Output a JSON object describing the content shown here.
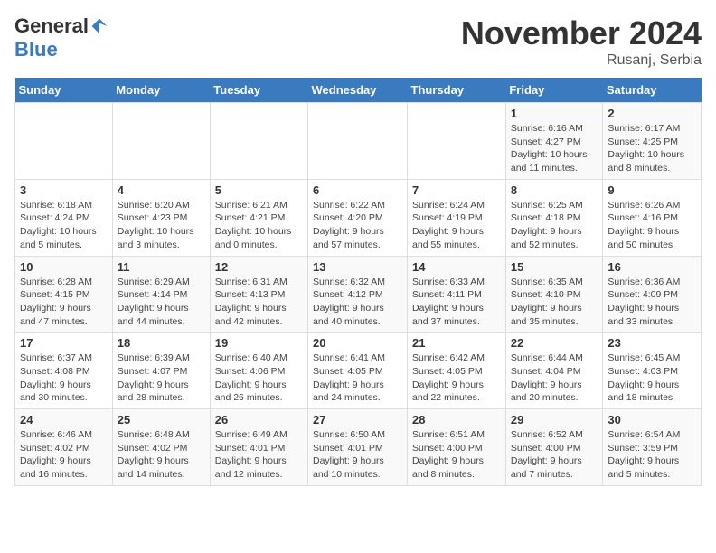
{
  "logo": {
    "general": "General",
    "blue": "Blue"
  },
  "header": {
    "month": "November 2024",
    "location": "Rusanj, Serbia"
  },
  "weekdays": [
    "Sunday",
    "Monday",
    "Tuesday",
    "Wednesday",
    "Thursday",
    "Friday",
    "Saturday"
  ],
  "weeks": [
    [
      {
        "day": "",
        "info": ""
      },
      {
        "day": "",
        "info": ""
      },
      {
        "day": "",
        "info": ""
      },
      {
        "day": "",
        "info": ""
      },
      {
        "day": "",
        "info": ""
      },
      {
        "day": "1",
        "info": "Sunrise: 6:16 AM\nSunset: 4:27 PM\nDaylight: 10 hours and 11 minutes."
      },
      {
        "day": "2",
        "info": "Sunrise: 6:17 AM\nSunset: 4:25 PM\nDaylight: 10 hours and 8 minutes."
      }
    ],
    [
      {
        "day": "3",
        "info": "Sunrise: 6:18 AM\nSunset: 4:24 PM\nDaylight: 10 hours and 5 minutes."
      },
      {
        "day": "4",
        "info": "Sunrise: 6:20 AM\nSunset: 4:23 PM\nDaylight: 10 hours and 3 minutes."
      },
      {
        "day": "5",
        "info": "Sunrise: 6:21 AM\nSunset: 4:21 PM\nDaylight: 10 hours and 0 minutes."
      },
      {
        "day": "6",
        "info": "Sunrise: 6:22 AM\nSunset: 4:20 PM\nDaylight: 9 hours and 57 minutes."
      },
      {
        "day": "7",
        "info": "Sunrise: 6:24 AM\nSunset: 4:19 PM\nDaylight: 9 hours and 55 minutes."
      },
      {
        "day": "8",
        "info": "Sunrise: 6:25 AM\nSunset: 4:18 PM\nDaylight: 9 hours and 52 minutes."
      },
      {
        "day": "9",
        "info": "Sunrise: 6:26 AM\nSunset: 4:16 PM\nDaylight: 9 hours and 50 minutes."
      }
    ],
    [
      {
        "day": "10",
        "info": "Sunrise: 6:28 AM\nSunset: 4:15 PM\nDaylight: 9 hours and 47 minutes."
      },
      {
        "day": "11",
        "info": "Sunrise: 6:29 AM\nSunset: 4:14 PM\nDaylight: 9 hours and 44 minutes."
      },
      {
        "day": "12",
        "info": "Sunrise: 6:31 AM\nSunset: 4:13 PM\nDaylight: 9 hours and 42 minutes."
      },
      {
        "day": "13",
        "info": "Sunrise: 6:32 AM\nSunset: 4:12 PM\nDaylight: 9 hours and 40 minutes."
      },
      {
        "day": "14",
        "info": "Sunrise: 6:33 AM\nSunset: 4:11 PM\nDaylight: 9 hours and 37 minutes."
      },
      {
        "day": "15",
        "info": "Sunrise: 6:35 AM\nSunset: 4:10 PM\nDaylight: 9 hours and 35 minutes."
      },
      {
        "day": "16",
        "info": "Sunrise: 6:36 AM\nSunset: 4:09 PM\nDaylight: 9 hours and 33 minutes."
      }
    ],
    [
      {
        "day": "17",
        "info": "Sunrise: 6:37 AM\nSunset: 4:08 PM\nDaylight: 9 hours and 30 minutes."
      },
      {
        "day": "18",
        "info": "Sunrise: 6:39 AM\nSunset: 4:07 PM\nDaylight: 9 hours and 28 minutes."
      },
      {
        "day": "19",
        "info": "Sunrise: 6:40 AM\nSunset: 4:06 PM\nDaylight: 9 hours and 26 minutes."
      },
      {
        "day": "20",
        "info": "Sunrise: 6:41 AM\nSunset: 4:05 PM\nDaylight: 9 hours and 24 minutes."
      },
      {
        "day": "21",
        "info": "Sunrise: 6:42 AM\nSunset: 4:05 PM\nDaylight: 9 hours and 22 minutes."
      },
      {
        "day": "22",
        "info": "Sunrise: 6:44 AM\nSunset: 4:04 PM\nDaylight: 9 hours and 20 minutes."
      },
      {
        "day": "23",
        "info": "Sunrise: 6:45 AM\nSunset: 4:03 PM\nDaylight: 9 hours and 18 minutes."
      }
    ],
    [
      {
        "day": "24",
        "info": "Sunrise: 6:46 AM\nSunset: 4:02 PM\nDaylight: 9 hours and 16 minutes."
      },
      {
        "day": "25",
        "info": "Sunrise: 6:48 AM\nSunset: 4:02 PM\nDaylight: 9 hours and 14 minutes."
      },
      {
        "day": "26",
        "info": "Sunrise: 6:49 AM\nSunset: 4:01 PM\nDaylight: 9 hours and 12 minutes."
      },
      {
        "day": "27",
        "info": "Sunrise: 6:50 AM\nSunset: 4:01 PM\nDaylight: 9 hours and 10 minutes."
      },
      {
        "day": "28",
        "info": "Sunrise: 6:51 AM\nSunset: 4:00 PM\nDaylight: 9 hours and 8 minutes."
      },
      {
        "day": "29",
        "info": "Sunrise: 6:52 AM\nSunset: 4:00 PM\nDaylight: 9 hours and 7 minutes."
      },
      {
        "day": "30",
        "info": "Sunrise: 6:54 AM\nSunset: 3:59 PM\nDaylight: 9 hours and 5 minutes."
      }
    ]
  ]
}
